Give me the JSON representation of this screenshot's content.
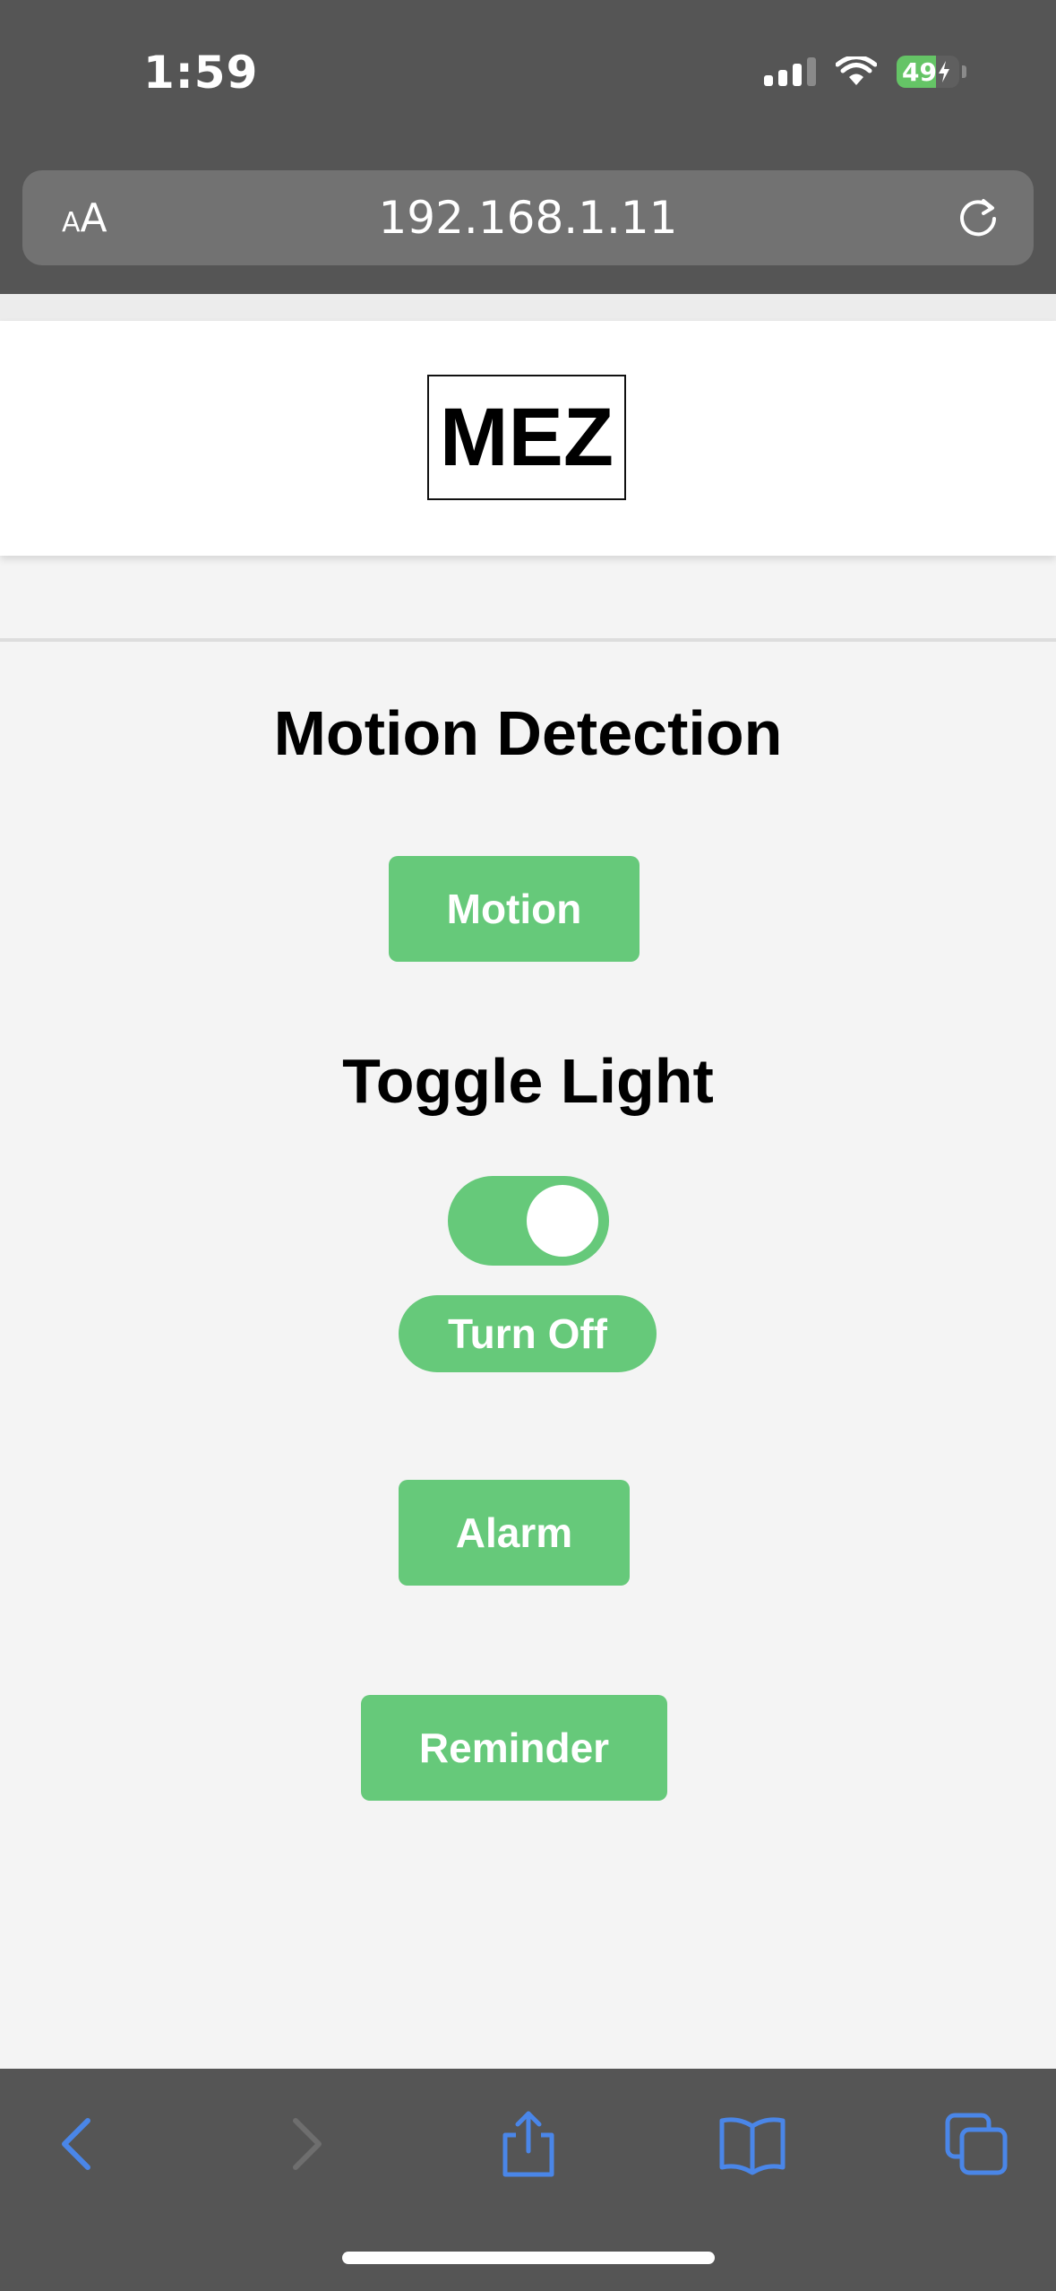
{
  "status_bar": {
    "time": "1:59",
    "battery": "49"
  },
  "address_bar": {
    "text_size_label_small": "A",
    "text_size_label_large": "A",
    "url": "192.168.1.11"
  },
  "header": {
    "logo_text": "MEZ"
  },
  "motion_section": {
    "title": "Motion Detection",
    "button_label": "Motion"
  },
  "light_section": {
    "title": "Toggle Light",
    "toggle_on": true,
    "toggle_button_label": "Turn Off"
  },
  "alarm_button_label": "Alarm",
  "reminder_button_label": "Reminder",
  "colors": {
    "accent_green": "#66c97a",
    "chrome_gray": "#555555",
    "toolbar_blue": "#4a86e8"
  },
  "toolbar": {
    "icons": [
      "back-icon",
      "forward-icon",
      "share-icon",
      "bookmarks-icon",
      "tabs-icon"
    ]
  }
}
